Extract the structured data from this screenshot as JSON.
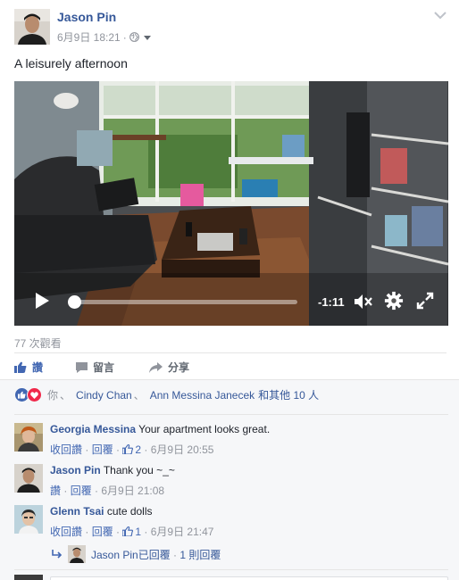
{
  "post": {
    "author": "Jason Pin",
    "timestamp": "6月9日 18:21",
    "separator": " · ",
    "text": "A leisurely afternoon",
    "privacy_icon": "globe-icon",
    "options_icon": "chevron-down-icon"
  },
  "video": {
    "time_remaining": "-1:11",
    "progress_fraction": 0.02,
    "controls": [
      "play-icon",
      "mute-icon",
      "settings-icon",
      "fullscreen-icon"
    ]
  },
  "views": "77 次觀看",
  "actions": {
    "like": "讚",
    "comment": "留言",
    "share": "分享"
  },
  "reactions": {
    "you": "你",
    "sep": "、",
    "name1": "Cindy Chan",
    "name2": "Ann Messina Janecek",
    "others": "和其他 10 人"
  },
  "comments": [
    {
      "author": "Georgia Messina",
      "text": "Your apartment looks great.",
      "reply": "收回讚",
      "reply2": "回覆",
      "likes": "2",
      "time": "6月9日 20:55"
    },
    {
      "author": "Jason Pin",
      "text": "Thank you ~_~",
      "reply": "讚",
      "reply2": "回覆",
      "time": "6月9日 21:08"
    },
    {
      "author": "Glenn Tsai",
      "text": "cute dolls",
      "reply": "收回讚",
      "reply2": "回覆",
      "likes": "1",
      "time": "6月9日 21:47"
    }
  ],
  "replies_summary": {
    "name": "Jason Pin",
    "action": "已回覆",
    "dot": " · ",
    "count": "1 則回覆"
  },
  "colors": {
    "link": "#365899",
    "accent": "#4267b2",
    "meta_gray": "#90949c",
    "love": "#f0284a"
  }
}
